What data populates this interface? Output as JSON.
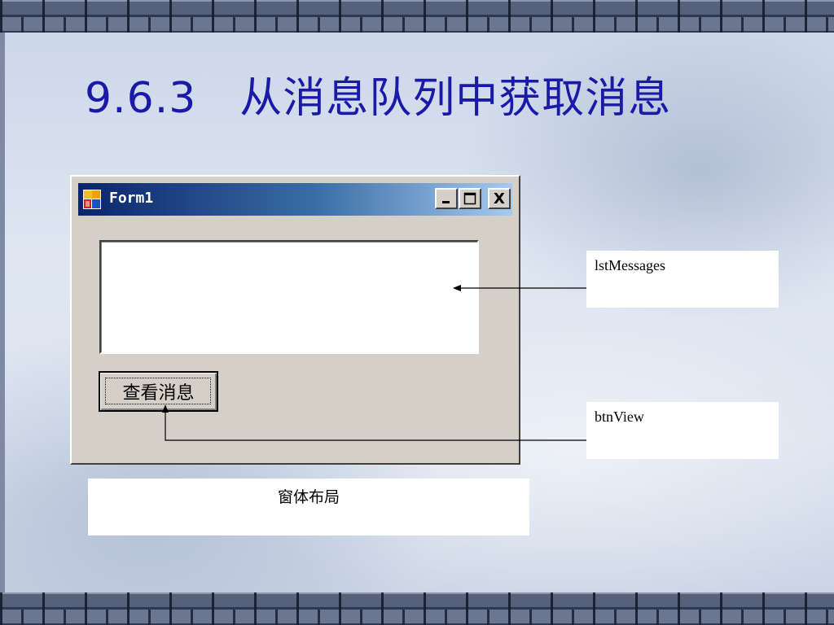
{
  "slide": {
    "title": "9.6.3　从消息队列中获取消息"
  },
  "window": {
    "title": "Form1",
    "icon": "form-app-icon",
    "controls": {
      "minimize_icon": "minimize-icon",
      "maximize_icon": "maximize-icon",
      "close_label": "X"
    },
    "view_button_label": "查看消息"
  },
  "callouts": {
    "list_label": "lstMessages",
    "button_label": "btnView",
    "caption": "窗体布局"
  },
  "colors": {
    "title_text": "#1a1aa8",
    "titlebar_start": "#0a246a",
    "titlebar_end": "#a6caf0",
    "window_face": "#d4d0c8"
  }
}
